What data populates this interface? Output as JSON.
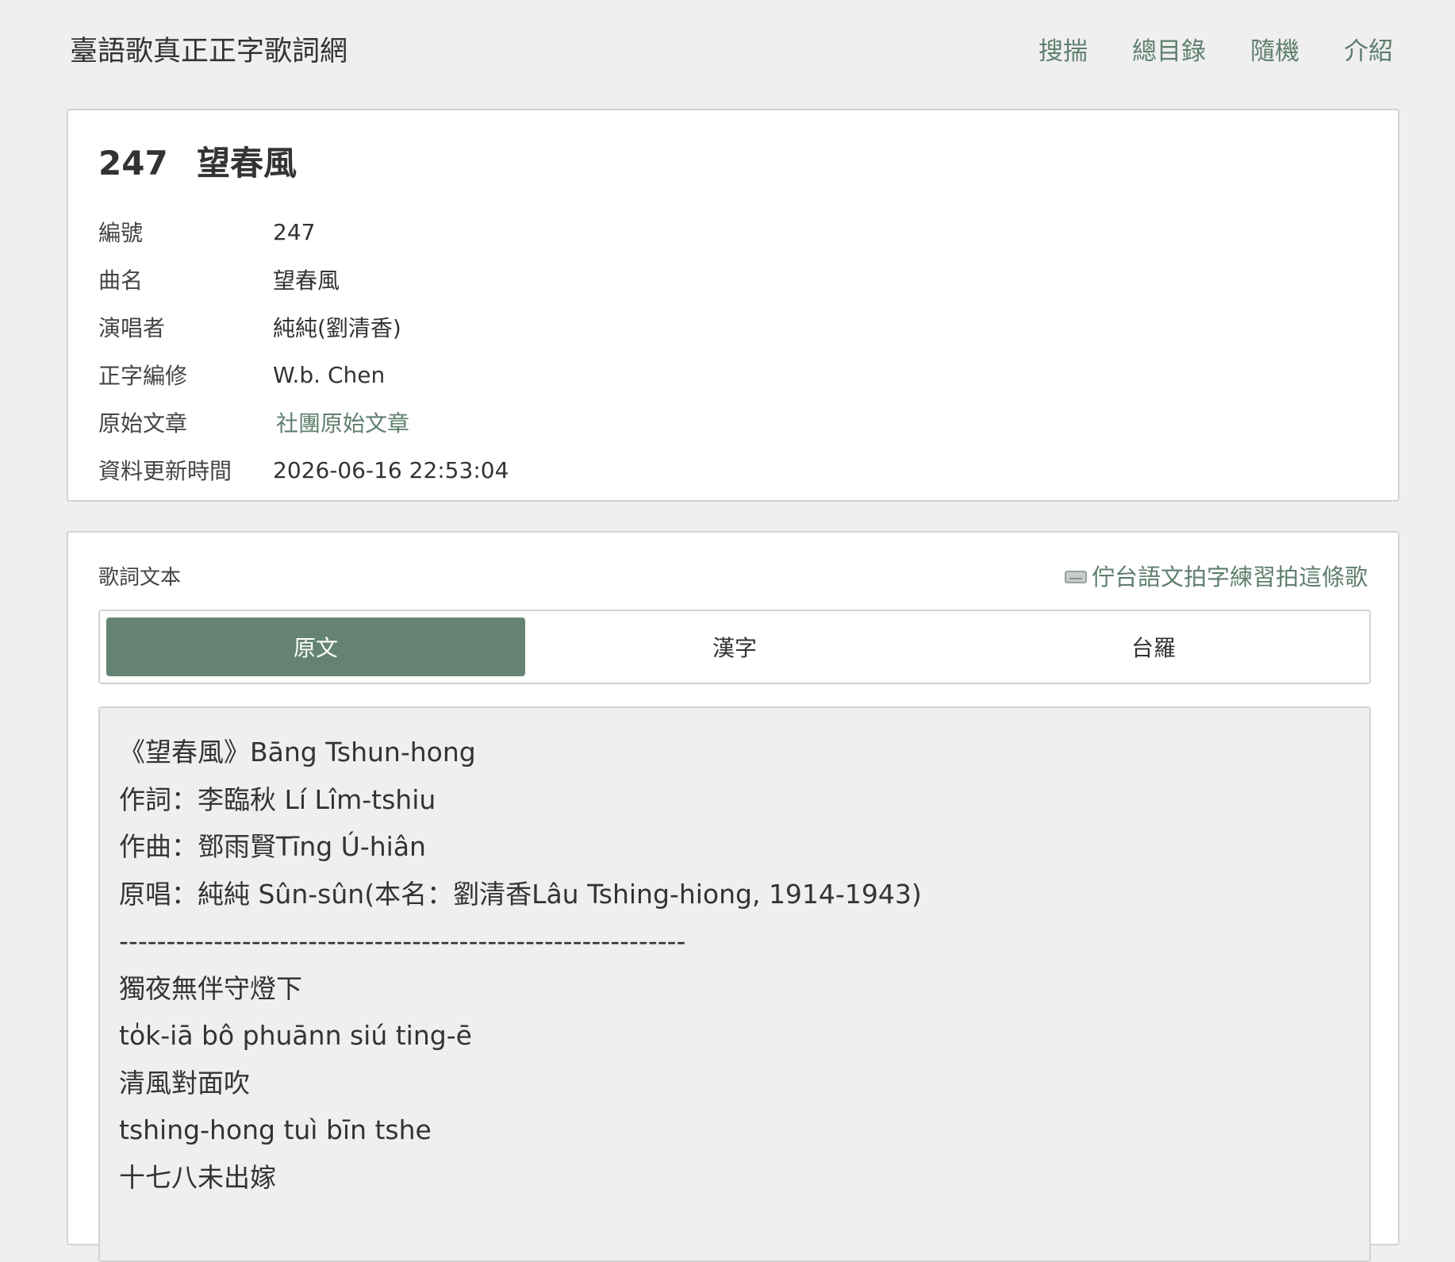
{
  "header": {
    "site_title": "臺語歌真正正字歌詞網",
    "nav": [
      {
        "label": "搜揣"
      },
      {
        "label": "總目錄"
      },
      {
        "label": "隨機"
      },
      {
        "label": "介紹"
      }
    ]
  },
  "song": {
    "number": "247",
    "title": "望春風",
    "meta": [
      {
        "key": "編號",
        "value": "247",
        "is_link": false
      },
      {
        "key": "曲名",
        "value": "望春風",
        "is_link": false
      },
      {
        "key": "演唱者",
        "value": "純純(劉清香)",
        "is_link": false
      },
      {
        "key": "正字編修",
        "value": "W.b. Chen",
        "is_link": false
      },
      {
        "key": "原始文章",
        "value": "社團原始文章",
        "is_link": true
      },
      {
        "key": "資料更新時間",
        "value": "2026-06-16 22:53:04",
        "is_link": false
      }
    ]
  },
  "lyrics": {
    "section_label": "歌詞文本",
    "practice_link": "佇台語文拍字練習拍這條歌",
    "practice_icon": "keyboard-icon",
    "tabs": [
      {
        "label": "原文",
        "active": true
      },
      {
        "label": "漢字",
        "active": false
      },
      {
        "label": "台羅",
        "active": false
      }
    ],
    "lines": [
      "《望春風》Bāng Tshun-hong",
      "作詞：李臨秋 Lí Lîm-tshiu",
      "作曲：鄧雨賢Tīng Ú-hiân",
      "原唱：純純 Sûn-sûn(本名：劉清香Lâu Tshing-hiong, 1914-1943)",
      "------------------------------------------------------------",
      "獨夜無伴守燈下",
      "to̍k-iā bô phuānn siú ting-ē",
      "清風對面吹",
      "tshing-hong tuì bīn tshe",
      "十七八未出嫁"
    ]
  },
  "colors": {
    "accent": "#658373",
    "link": "#5f7f6e",
    "background": "#efefef"
  }
}
